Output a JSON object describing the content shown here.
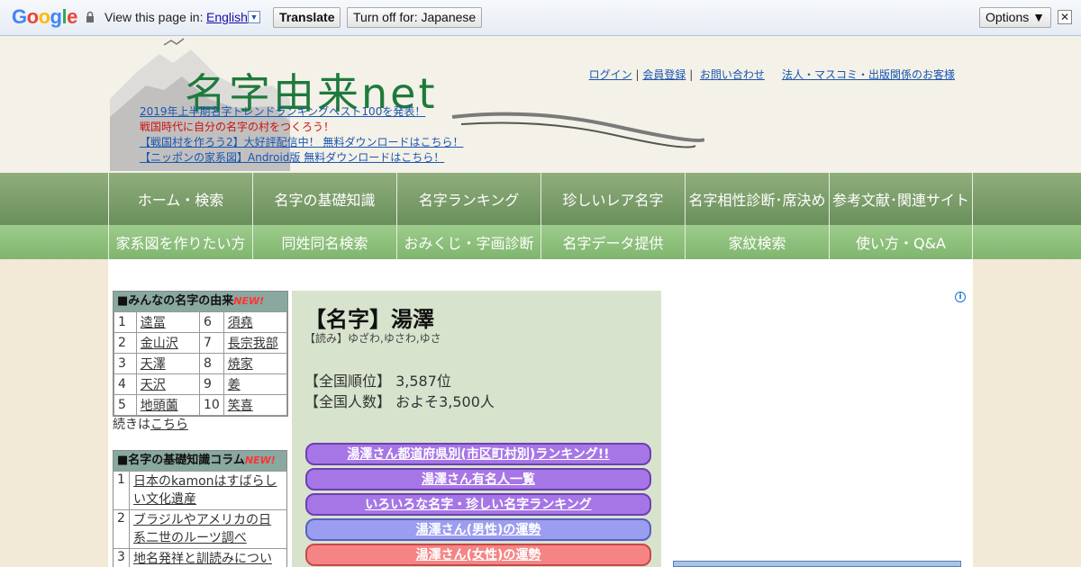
{
  "translate_bar": {
    "logo": "Google",
    "view_label": "View this page in:",
    "language": "English",
    "translate_button": "Translate",
    "turn_off_button": "Turn off for: Japanese",
    "options_button": "Options ▼",
    "close": "✕"
  },
  "header": {
    "site_title": "名字由来net",
    "news": [
      "2019年上半期名字トレンドランキングベスト100を発表！",
      "戦国時代に自分の名字の村をつくろう！",
      "【戦国村を作ろう2】大好評配信中！ 無料ダウンロードはこちら！",
      "【ニッポンの家系図】Android版 無料ダウンロードはこちら！"
    ],
    "links": {
      "login": "ログイン",
      "register": "会員登録",
      "contact": "お問い合わせ",
      "corporate": "法人・マスコミ・出版関係のお客様"
    }
  },
  "nav_primary": [
    "ホーム・検索",
    "名字の基礎知識",
    "名字ランキング",
    "珍しいレア名字",
    "名字相性診断･席決め",
    "参考文献･関連サイト"
  ],
  "nav_secondary": [
    "家系図を作りたい方",
    "同姓同名検索",
    "おみくじ・字画診断",
    "名字データ提供",
    "家紋検索",
    "使い方・Q&A"
  ],
  "sidebar": {
    "origins_title": "■みんなの名字の由来",
    "new_badge": "NEW!",
    "origins": [
      {
        "n1": "1",
        "name1": "逵冨",
        "n2": "6",
        "name2": "須堯"
      },
      {
        "n1": "2",
        "name1": "金山沢",
        "n2": "7",
        "name2": "長宗我部"
      },
      {
        "n1": "3",
        "name1": "天澤",
        "n2": "8",
        "name2": "焼家"
      },
      {
        "n1": "4",
        "name1": "天沢",
        "n2": "9",
        "name2": "姜"
      },
      {
        "n1": "5",
        "name1": "地頭薗",
        "n2": "10",
        "name2": "笑喜"
      }
    ],
    "more_prefix": "続きは",
    "more_link": "こちら",
    "column_title": "■名字の基礎知識コラム",
    "columns": [
      {
        "n": "1",
        "title": "日本のkamonはすばらしい文化遺産"
      },
      {
        "n": "2",
        "title": "ブラジルやアメリカの日系二世のルーツ調べ"
      },
      {
        "n": "3",
        "title": "地名発祥と訓読みについて"
      }
    ]
  },
  "main": {
    "title": "【名字】湯澤",
    "reading": "【読み】ゆざわ,ゆさわ,ゆさ",
    "rank_label": "【全国順位】",
    "rank_value": "3,587位",
    "population_label": "【全国人数】",
    "population_value": "およそ3,500人",
    "buttons": [
      "湯澤さん都道府県別(市区町村別)ランキング!!",
      "湯澤さん有名人一覧",
      "いろいろな名字・珍しい名字ランキング",
      "湯澤さん(男性)の運勢",
      "湯澤さん(女性)の運勢"
    ]
  },
  "colors": {
    "nav_primary": "#7a9d68",
    "nav_secondary": "#8fc27d",
    "title_green": "#1e7a3c",
    "main_bg": "#d8e3cd"
  }
}
